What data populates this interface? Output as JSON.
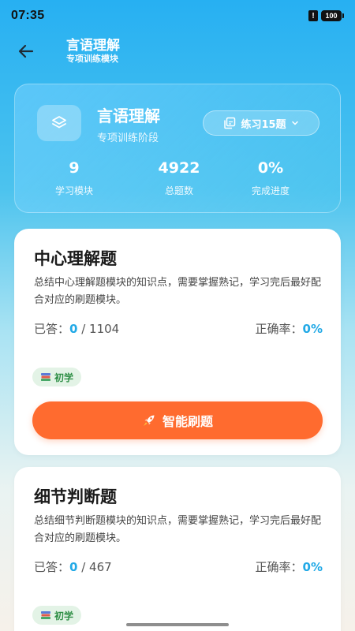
{
  "status_bar": {
    "time": "07:35",
    "alert": "!",
    "battery": "100"
  },
  "header": {
    "title": "言语理解",
    "subtitle": "专项训练模块"
  },
  "summary": {
    "title": "言语理解",
    "stage": "专项训练阶段",
    "practice_label": "练习15题",
    "stats": [
      {
        "value": "9",
        "label": "学习模块"
      },
      {
        "value": "4922",
        "label": "总题数"
      },
      {
        "value": "0%",
        "label": "完成进度"
      }
    ]
  },
  "topics": [
    {
      "title": "中心理解题",
      "description": "总结中心理解题模块的知识点，需要掌握熟记，学习完后最好配合对应的刷题模块。",
      "answered_label": "已答：",
      "answered": "0",
      "separator": " / ",
      "total": "1104",
      "accuracy_label": "正确率：",
      "accuracy": "0%",
      "level": "初学",
      "button_label": "智能刷题"
    },
    {
      "title": "细节判断题",
      "description": "总结细节判断题模块的知识点，需要掌握熟记，学习完后最好配合对应的刷题模块。",
      "answered_label": "已答：",
      "answered": "0",
      "separator": " / ",
      "total": "467",
      "accuracy_label": "正确率：",
      "accuracy": "0%",
      "level": "初学"
    }
  ],
  "icons": {
    "back": "arrow-left-icon",
    "module": "layers-icon",
    "practice": "copy-icon",
    "dropdown": "chevron-down-icon",
    "level": "books-icon",
    "smart": "rocket-icon"
  },
  "colors": {
    "accent": "#22a9e6",
    "button": "#ff6b2f",
    "badge_text": "#2f8f46",
    "badge_bg": "#e3f3e6"
  }
}
